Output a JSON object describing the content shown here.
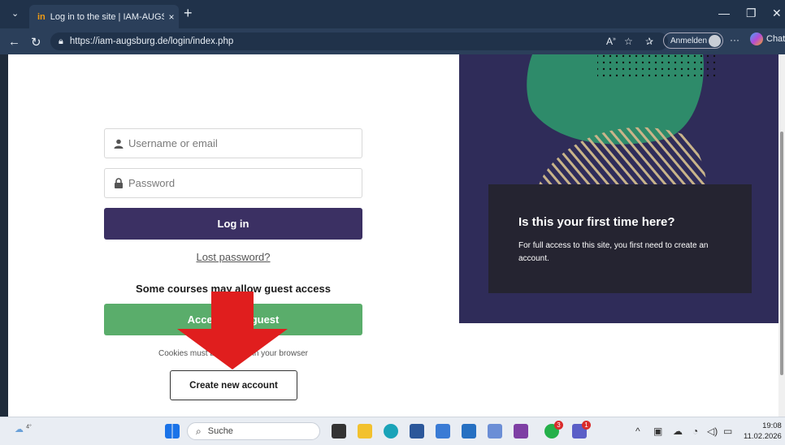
{
  "browser": {
    "tab_title": "Log in to the site | IAM-AUGSBURG",
    "tab_favicon": "in",
    "tab_close": "×",
    "new_tab": "+",
    "url": "https://iam-augsburg.de/login/index.php",
    "signin_label": "Anmelden",
    "chat_label": "Chat",
    "icons": [
      "back-icon",
      "refresh-icon",
      "lock-icon",
      "read-aloud-icon",
      "favorite-icon",
      "favorites-list-icon",
      "more-icon",
      "copilot-icon"
    ]
  },
  "login": {
    "username_placeholder": "Username or email",
    "password_placeholder": "Password",
    "login_button": "Log in",
    "lost_password": "Lost password?",
    "guest_text": "Some courses may allow guest access",
    "guest_button": "Access as a guest",
    "cookies_text": "Cookies must be enabled in your browser",
    "create_account": "Create new account"
  },
  "signup_panel": {
    "title": "Is this your first time here?",
    "text": "For full access to this site, you first need to create an account."
  },
  "colors": {
    "primary": "#3b3063",
    "guest_green": "#5aad6b",
    "panel_bg": "#2f2c59",
    "arrow_red": "#e01e1e"
  },
  "taskbar": {
    "weather": "4°",
    "search_label": "Suche",
    "time": "19:08",
    "date": "11.02.2026",
    "whatsapp_badge": "3",
    "teams_badge": "1"
  }
}
